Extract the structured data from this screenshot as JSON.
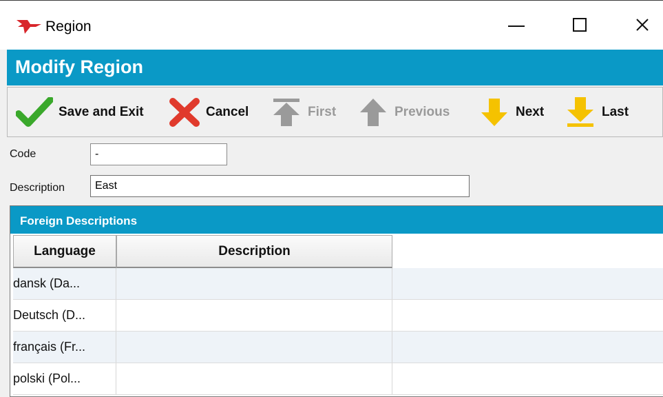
{
  "window": {
    "title": "Region",
    "icon": "app-logo-icon",
    "controls": [
      "minimize",
      "maximize",
      "close"
    ]
  },
  "header": {
    "title": "Modify Region"
  },
  "toolbar": {
    "save_label": "Save and Exit",
    "cancel_label": "Cancel",
    "first_label": "First",
    "previous_label": "Previous",
    "next_label": "Next",
    "last_label": "Last"
  },
  "form": {
    "code_label": "Code",
    "code_value": "-",
    "description_label": "Description",
    "description_value": "East"
  },
  "foreign_descriptions": {
    "title": "Foreign Descriptions",
    "columns": [
      "Language",
      "Description"
    ],
    "rows": [
      {
        "language": "dansk (Da...",
        "description": ""
      },
      {
        "language": "Deutsch (D...",
        "description": ""
      },
      {
        "language": "français (Fr...",
        "description": ""
      },
      {
        "language": "polski (Pol...",
        "description": ""
      }
    ]
  },
  "colors": {
    "accent": "#0a99c6",
    "save_green": "#3aa82b",
    "cancel_red": "#e03a2c",
    "nav_yellow": "#f5c200",
    "disabled_gray": "#9a9a9a"
  }
}
